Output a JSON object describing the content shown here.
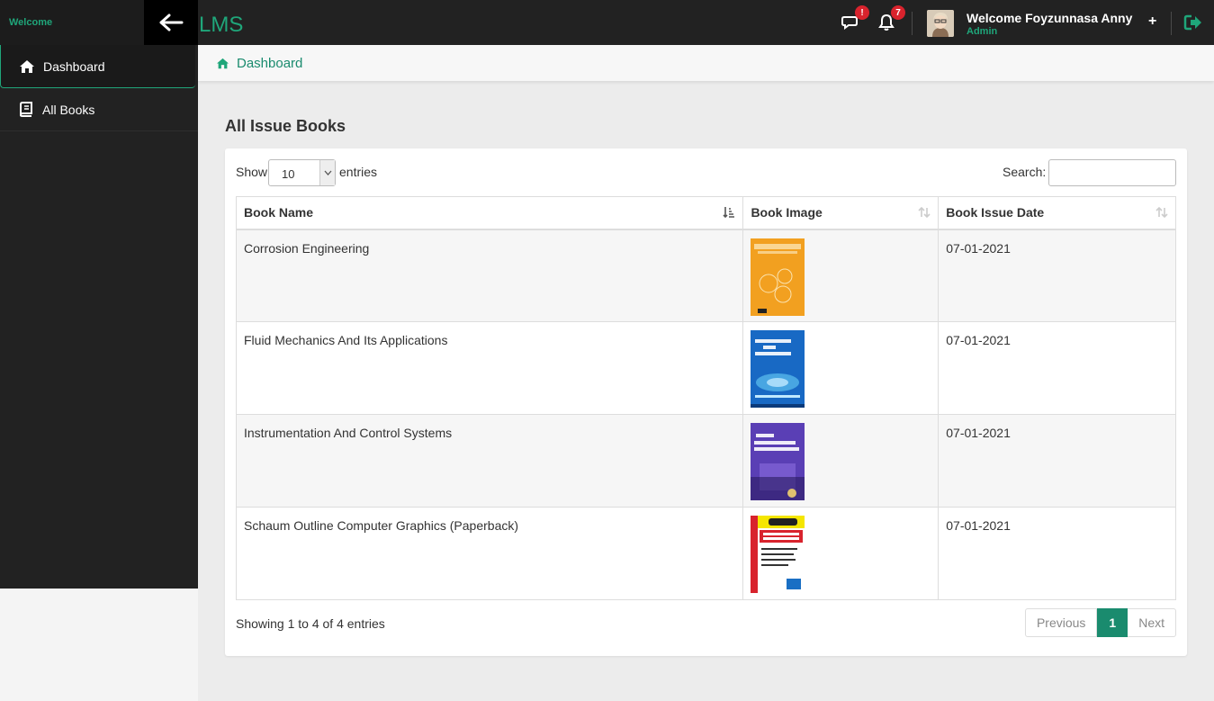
{
  "header": {
    "welcome": "Welcome",
    "app_title": "LMS",
    "messages_badge": "!",
    "notifications_badge": "7",
    "user_name": "Welcome Foyzunnasa Anny",
    "user_role": "Admin",
    "plus": "+",
    "accent": "#1fa67a"
  },
  "sidebar": {
    "items": [
      {
        "label": "Dashboard",
        "icon": "home-icon",
        "active": true
      },
      {
        "label": "All Books",
        "icon": "book-icon",
        "active": false
      }
    ]
  },
  "breadcrumb": {
    "label": "Dashboard"
  },
  "page": {
    "heading": "All Issue Books"
  },
  "table_controls": {
    "show_label": "Show",
    "entries_value": "10",
    "entries_label": "entries",
    "search_label": "Search:",
    "search_value": ""
  },
  "table": {
    "headers": [
      "Book Name",
      "Book Image",
      "Book Issue Date"
    ],
    "rows": [
      {
        "name": "Corrosion Engineering",
        "image": "corrosion-engineering-cover",
        "date": "07-01-2021",
        "cover_color": "#f2a020"
      },
      {
        "name": "Fluid Mechanics And Its Applications",
        "image": "fluid-mechanics-cover",
        "date": "07-01-2021",
        "cover_color": "#1869c4"
      },
      {
        "name": "Instrumentation And Control Systems",
        "image": "instrumentation-cover",
        "date": "07-01-2021",
        "cover_color": "#5a3fb5"
      },
      {
        "name": "Schaum Outline Computer Graphics (Paperback)",
        "image": "computer-graphics-cover",
        "date": "07-01-2021",
        "cover_color": "#f5e600"
      }
    ]
  },
  "footer": {
    "info": "Showing 1 to 4 of 4 entries",
    "previous": "Previous",
    "current_page": "1",
    "next": "Next"
  }
}
